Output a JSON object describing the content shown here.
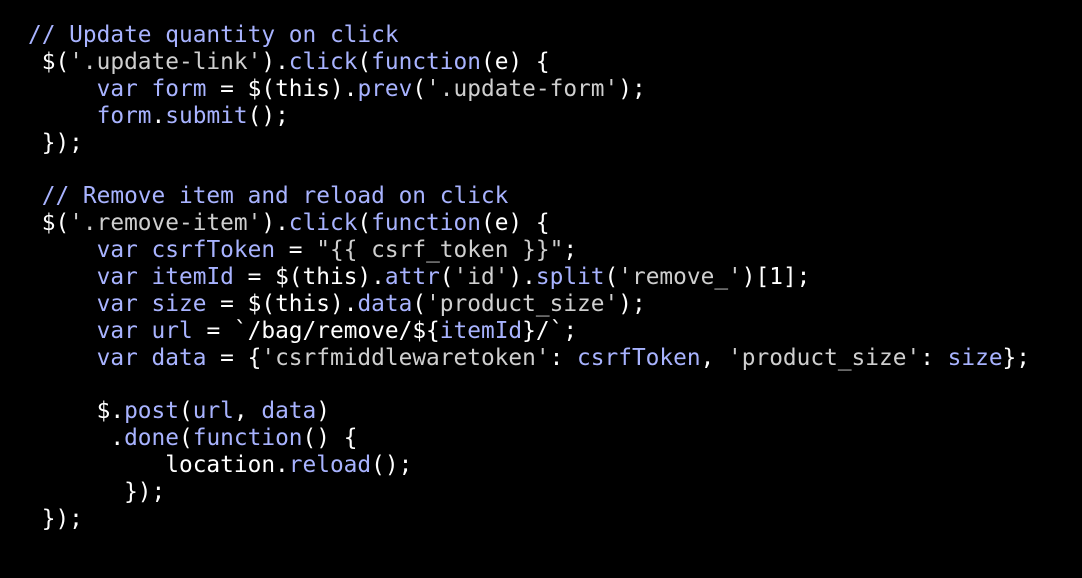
{
  "editor": {
    "theme": {
      "background": "#000000",
      "comment": "#a8b3ff",
      "keyword": "#a8b3ff",
      "string": "#cfcfcf",
      "plain": "#ffffff",
      "punct": "#ffffff"
    },
    "lines": [
      [
        {
          "t": "// Update quantity on click",
          "k": "comment"
        }
      ],
      [
        {
          "t": " $(",
          "k": "plain"
        },
        {
          "t": "'.update-link'",
          "k": "string"
        },
        {
          "t": ").",
          "k": "plain"
        },
        {
          "t": "click",
          "k": "keyword"
        },
        {
          "t": "(",
          "k": "plain"
        },
        {
          "t": "function",
          "k": "keyword"
        },
        {
          "t": "(e) {",
          "k": "plain"
        }
      ],
      [
        {
          "t": "     ",
          "k": "plain"
        },
        {
          "t": "var",
          "k": "keyword"
        },
        {
          "t": " ",
          "k": "plain"
        },
        {
          "t": "form",
          "k": "keyword"
        },
        {
          "t": " = $(this).",
          "k": "plain"
        },
        {
          "t": "prev",
          "k": "keyword"
        },
        {
          "t": "(",
          "k": "plain"
        },
        {
          "t": "'.update-form'",
          "k": "string"
        },
        {
          "t": ");",
          "k": "plain"
        }
      ],
      [
        {
          "t": "     ",
          "k": "plain"
        },
        {
          "t": "form",
          "k": "keyword"
        },
        {
          "t": ".",
          "k": "plain"
        },
        {
          "t": "submit",
          "k": "keyword"
        },
        {
          "t": "();",
          "k": "plain"
        }
      ],
      [
        {
          "t": " });",
          "k": "plain"
        }
      ],
      [
        {
          "t": "",
          "k": "plain"
        }
      ],
      [
        {
          "t": " // Remove item and reload on click",
          "k": "comment"
        }
      ],
      [
        {
          "t": " $(",
          "k": "plain"
        },
        {
          "t": "'.remove-item'",
          "k": "string"
        },
        {
          "t": ").",
          "k": "plain"
        },
        {
          "t": "click",
          "k": "keyword"
        },
        {
          "t": "(",
          "k": "plain"
        },
        {
          "t": "function",
          "k": "keyword"
        },
        {
          "t": "(e) {",
          "k": "plain"
        }
      ],
      [
        {
          "t": "     ",
          "k": "plain"
        },
        {
          "t": "var",
          "k": "keyword"
        },
        {
          "t": " ",
          "k": "plain"
        },
        {
          "t": "csrfToken",
          "k": "keyword"
        },
        {
          "t": " = ",
          "k": "plain"
        },
        {
          "t": "\"{{ csrf_token }}\"",
          "k": "string"
        },
        {
          "t": ";",
          "k": "plain"
        }
      ],
      [
        {
          "t": "     ",
          "k": "plain"
        },
        {
          "t": "var",
          "k": "keyword"
        },
        {
          "t": " ",
          "k": "plain"
        },
        {
          "t": "itemId",
          "k": "keyword"
        },
        {
          "t": " = $(this).",
          "k": "plain"
        },
        {
          "t": "attr",
          "k": "keyword"
        },
        {
          "t": "(",
          "k": "plain"
        },
        {
          "t": "'id'",
          "k": "string"
        },
        {
          "t": ").",
          "k": "plain"
        },
        {
          "t": "split",
          "k": "keyword"
        },
        {
          "t": "(",
          "k": "plain"
        },
        {
          "t": "'remove_'",
          "k": "string"
        },
        {
          "t": ")[1];",
          "k": "plain"
        }
      ],
      [
        {
          "t": "     ",
          "k": "plain"
        },
        {
          "t": "var",
          "k": "keyword"
        },
        {
          "t": " ",
          "k": "plain"
        },
        {
          "t": "size",
          "k": "keyword"
        },
        {
          "t": " = $(this).",
          "k": "plain"
        },
        {
          "t": "data",
          "k": "keyword"
        },
        {
          "t": "(",
          "k": "plain"
        },
        {
          "t": "'product_size'",
          "k": "string"
        },
        {
          "t": ");",
          "k": "plain"
        }
      ],
      [
        {
          "t": "     ",
          "k": "plain"
        },
        {
          "t": "var",
          "k": "keyword"
        },
        {
          "t": " ",
          "k": "plain"
        },
        {
          "t": "url",
          "k": "keyword"
        },
        {
          "t": " = `/bag/remove/${",
          "k": "plain"
        },
        {
          "t": "itemId",
          "k": "keyword"
        },
        {
          "t": "}/`;",
          "k": "plain"
        }
      ],
      [
        {
          "t": "     ",
          "k": "plain"
        },
        {
          "t": "var",
          "k": "keyword"
        },
        {
          "t": " ",
          "k": "plain"
        },
        {
          "t": "data",
          "k": "keyword"
        },
        {
          "t": " = {",
          "k": "plain"
        },
        {
          "t": "'csrfmiddlewaretoken'",
          "k": "string"
        },
        {
          "t": ": ",
          "k": "plain"
        },
        {
          "t": "csrfToken",
          "k": "keyword"
        },
        {
          "t": ", ",
          "k": "plain"
        },
        {
          "t": "'product_size'",
          "k": "string"
        },
        {
          "t": ": ",
          "k": "plain"
        },
        {
          "t": "size",
          "k": "keyword"
        },
        {
          "t": "};",
          "k": "plain"
        }
      ],
      [
        {
          "t": "",
          "k": "plain"
        }
      ],
      [
        {
          "t": "     $.",
          "k": "plain"
        },
        {
          "t": "post",
          "k": "keyword"
        },
        {
          "t": "(",
          "k": "plain"
        },
        {
          "t": "url",
          "k": "keyword"
        },
        {
          "t": ", ",
          "k": "plain"
        },
        {
          "t": "data",
          "k": "keyword"
        },
        {
          "t": ")",
          "k": "plain"
        }
      ],
      [
        {
          "t": "      .",
          "k": "plain"
        },
        {
          "t": "done",
          "k": "keyword"
        },
        {
          "t": "(",
          "k": "plain"
        },
        {
          "t": "function",
          "k": "keyword"
        },
        {
          "t": "() {",
          "k": "plain"
        }
      ],
      [
        {
          "t": "          location.",
          "k": "plain"
        },
        {
          "t": "reload",
          "k": "keyword"
        },
        {
          "t": "();",
          "k": "plain"
        }
      ],
      [
        {
          "t": "       });",
          "k": "plain"
        }
      ],
      [
        {
          "t": " });",
          "k": "plain"
        }
      ]
    ]
  }
}
